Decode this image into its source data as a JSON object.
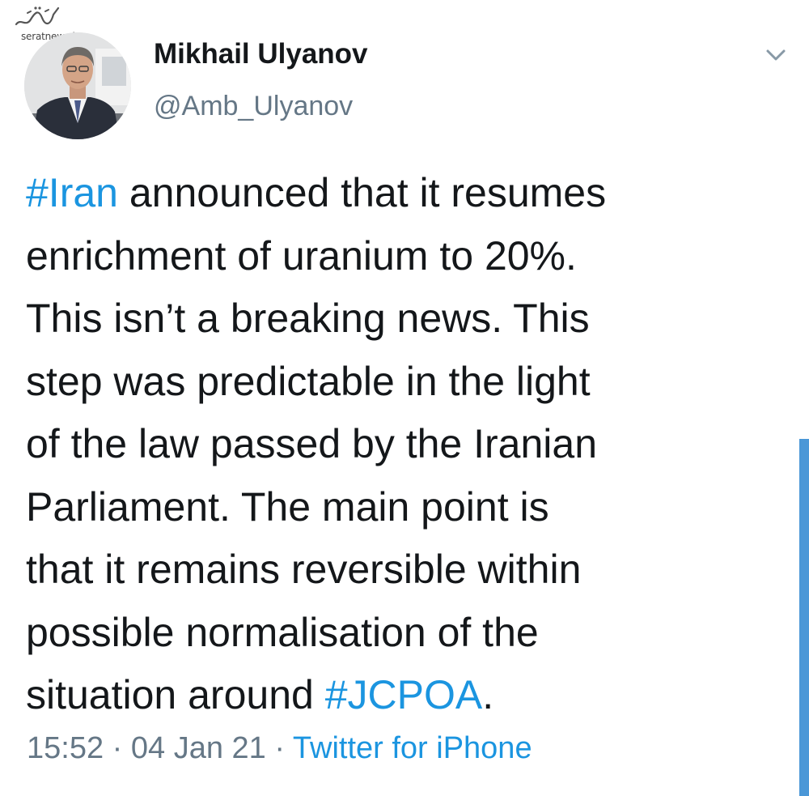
{
  "watermark": {
    "site": "seratnews.ir"
  },
  "author": {
    "display_name": "Mikhail Ulyanov",
    "handle": "@Amb_Ulyanov"
  },
  "tweet": {
    "lines": [
      [
        {
          "text": "#Iran",
          "type": "hashtag"
        },
        {
          "text": " announced that it resumes",
          "type": "text"
        }
      ],
      [
        {
          "text": "enrichment of uranium to 20%.",
          "type": "text"
        }
      ],
      [
        {
          "text": "This isn’t a breaking news. This",
          "type": "text"
        }
      ],
      [
        {
          "text": "step was predictable in the light",
          "type": "text"
        }
      ],
      [
        {
          "text": "of the law passed by the Iranian",
          "type": "text"
        }
      ],
      [
        {
          "text": "Parliament. The main point is",
          "type": "text"
        }
      ],
      [
        {
          "text": "that it remains reversible within",
          "type": "text"
        }
      ],
      [
        {
          "text": "possible normalisation of the",
          "type": "text"
        }
      ],
      [
        {
          "text": "situation around ",
          "type": "text"
        },
        {
          "text": "#JCPOA",
          "type": "hashtag"
        },
        {
          "text": ".",
          "type": "text"
        }
      ]
    ]
  },
  "meta": {
    "time": "15:52",
    "separator": " · ",
    "date": "04 Jan 21",
    "source": "Twitter for iPhone"
  },
  "icons": {
    "caret": "chevron-down-icon"
  },
  "colors": {
    "link": "#1b95e0",
    "secondary_text": "#657786",
    "primary_text": "#14171a",
    "scrollbar": "#4a97d7"
  }
}
